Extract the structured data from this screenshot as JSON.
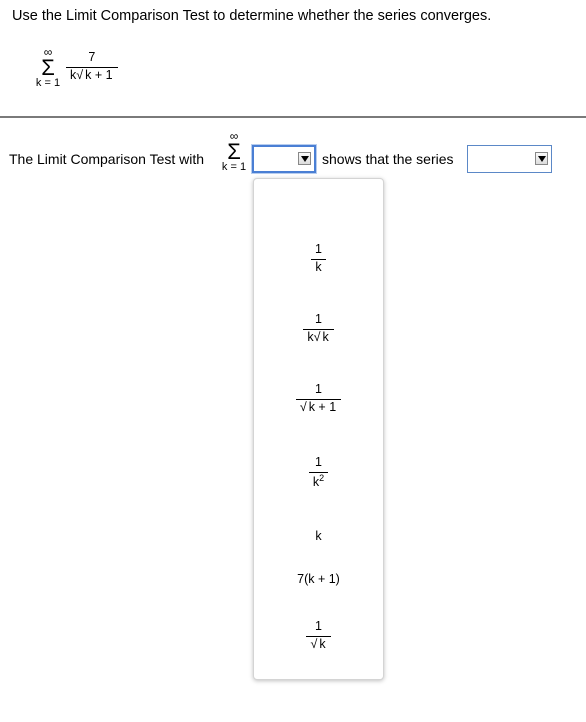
{
  "question": {
    "instruction": "Use the Limit Comparison Test to determine whether the series converges.",
    "series": {
      "sum_upper": "∞",
      "sum_symbol": "Σ",
      "sum_lower": "k = 1",
      "numerator": "7",
      "den_prefix": "k",
      "den_radicand": "k + 1"
    }
  },
  "answer_line": {
    "prefix_text": "The Limit Comparison Test with",
    "sum_upper": "∞",
    "sum_symbol": "Σ",
    "sum_lower": "k = 1",
    "dropdown1_value": "",
    "middle_text": "shows that the series",
    "dropdown2_value": ""
  },
  "dropdown_options": [
    {
      "num": "1",
      "den": "k"
    },
    {
      "num": "1",
      "den_prefix": "k",
      "den_radicand": "k"
    },
    {
      "num": "1",
      "den_radicand": "k + 1"
    },
    {
      "num": "1",
      "den_base": "k",
      "den_exp": "2"
    },
    {
      "text": "k"
    },
    {
      "text": "7(k + 1)"
    },
    {
      "num": "1",
      "den_radicand": "k"
    }
  ]
}
